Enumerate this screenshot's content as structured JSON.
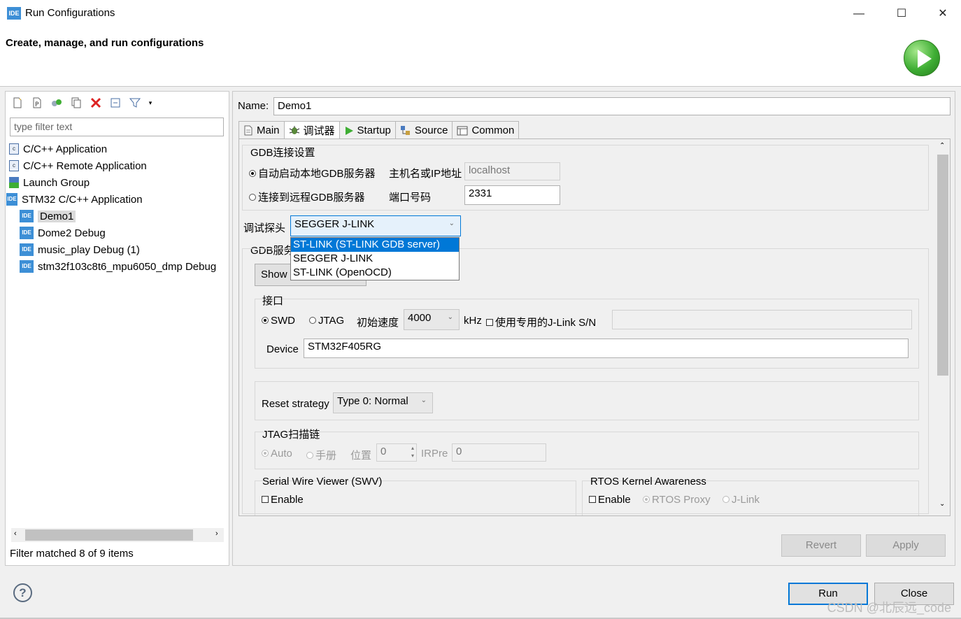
{
  "window": {
    "title": "Run Configurations",
    "app_icon": "IDE",
    "minimize": "—",
    "maximize": "☐",
    "close": "✕"
  },
  "header": {
    "text": "Create, manage, and run configurations"
  },
  "left": {
    "filter_placeholder": "type filter text",
    "items": [
      {
        "label": "C/C++ Application",
        "icon": "c-app-icon"
      },
      {
        "label": "C/C++ Remote Application",
        "icon": "c-remote-icon"
      },
      {
        "label": "Launch Group",
        "icon": "launch-group-icon"
      },
      {
        "label": "STM32 C/C++ Application",
        "icon": "stm32-icon"
      },
      {
        "label": "Demo1",
        "icon": "ide-icon"
      },
      {
        "label": "Dome2 Debug",
        "icon": "ide-icon"
      },
      {
        "label": "music_play Debug (1)",
        "icon": "ide-icon"
      },
      {
        "label": "stm32f103c8t6_mpu6050_dmp Debug",
        "icon": "ide-icon"
      }
    ],
    "status": "Filter matched 8 of 9 items"
  },
  "right": {
    "name_label": "Name:",
    "name_value": "Demo1",
    "tabs": [
      {
        "label": "Main"
      },
      {
        "label": "调试器"
      },
      {
        "label": "Startup"
      },
      {
        "label": "Source"
      },
      {
        "label": "Common"
      }
    ],
    "gdb_conn": {
      "title": "GDB连接设置",
      "auto_local": "自动启动本地GDB服务器",
      "host_label": "主机名或IP地址",
      "host_value": "localhost",
      "connect_remote": "连接到远程GDB服务器",
      "port_label": "端口号码",
      "port_value": "2331"
    },
    "probe": {
      "label": "调试探头",
      "value": "SEGGER J-LINK",
      "options": [
        "ST-LINK (ST-LINK GDB server)",
        "SEGGER J-LINK",
        "ST-LINK (OpenOCD)"
      ]
    },
    "gdb_server_label": "GDB服务",
    "show_button": "Show",
    "interface": {
      "title": "接口",
      "swd": "SWD",
      "jtag": "JTAG",
      "speed_label": "初始速度",
      "speed_value": "4000",
      "khz": "kHz",
      "use_sn": "使用专用的J-Link S/N",
      "device_label": "Device",
      "device_value": "STM32F405RG"
    },
    "reset": {
      "label": "Reset strategy",
      "value": "Type 0: Normal"
    },
    "jtag_chain": {
      "title": "JTAG扫描链",
      "auto": "Auto",
      "manual": "手册",
      "position_label": "位置",
      "position_value": "0",
      "irpre_label": "IRPre",
      "irpre_value": "0"
    },
    "swv": {
      "title": "Serial Wire Viewer (SWV)",
      "enable": "Enable"
    },
    "rtos": {
      "title": "RTOS Kernel Awareness",
      "enable": "Enable",
      "proxy": "RTOS Proxy",
      "jlink": "J-Link"
    },
    "revert": "Revert",
    "apply": "Apply"
  },
  "footer": {
    "run": "Run",
    "close": "Close",
    "help": "?",
    "watermark": "CSDN @北辰远_code"
  }
}
